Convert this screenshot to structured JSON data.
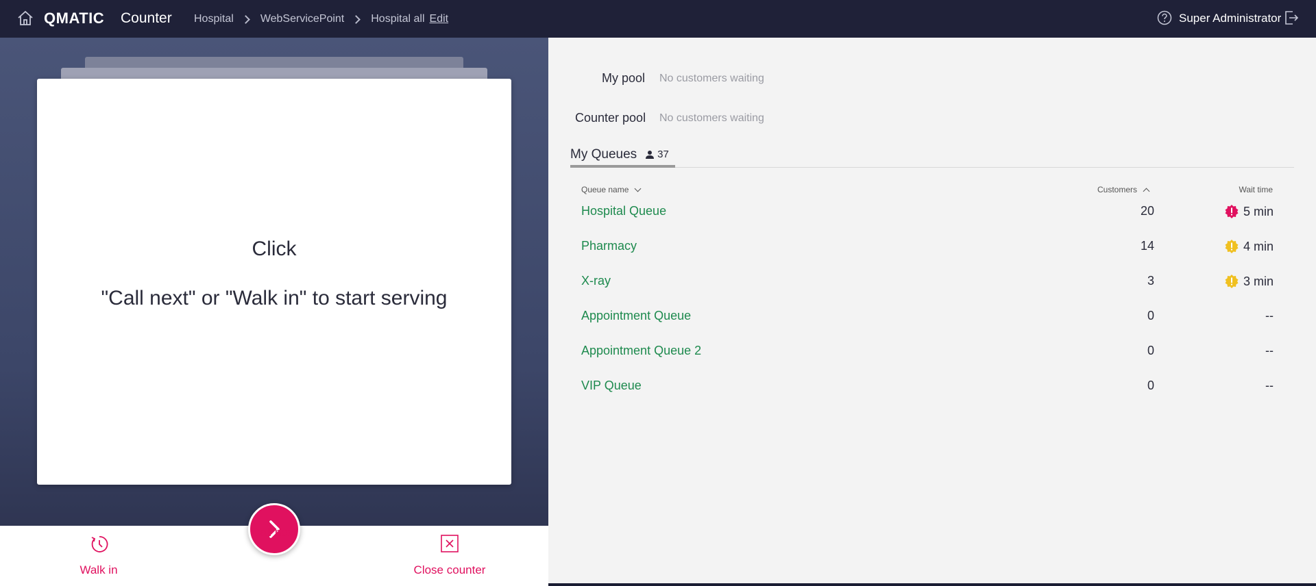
{
  "header": {
    "brand": "QMATIC",
    "app_title": "Counter",
    "breadcrumbs": [
      "Hospital",
      "WebServicePoint",
      "Hospital all"
    ],
    "edit_label": "Edit",
    "user_name": "Super Administrator"
  },
  "serving_card": {
    "title": "Click",
    "subtitle": "\"Call next\" or \"Walk in\" to start serving"
  },
  "actions": {
    "walk_in": "Walk in",
    "call_next": "Call next",
    "close_counter": "Close counter"
  },
  "pools": {
    "my_pool_label": "My pool",
    "my_pool_status": "No customers waiting",
    "counter_pool_label": "Counter pool",
    "counter_pool_status": "No customers waiting"
  },
  "queues": {
    "tab_label": "My Queues",
    "total_customers": "37",
    "columns": {
      "name": "Queue name",
      "customers": "Customers",
      "wait": "Wait time"
    },
    "rows": [
      {
        "name": "Hospital Queue",
        "customers": "20",
        "wait": "5 min",
        "level": "critical"
      },
      {
        "name": "Pharmacy",
        "customers": "14",
        "wait": "4 min",
        "level": "warning"
      },
      {
        "name": "X-ray",
        "customers": "3",
        "wait": "3 min",
        "level": "warning"
      },
      {
        "name": "Appointment Queue",
        "customers": "0",
        "wait": "--",
        "level": "none"
      },
      {
        "name": "Appointment Queue 2",
        "customers": "0",
        "wait": "--",
        "level": "none"
      },
      {
        "name": "VIP Queue",
        "customers": "0",
        "wait": "--",
        "level": "none"
      }
    ]
  },
  "colors": {
    "accent": "#e0115f",
    "queue_link": "#1e8a4e",
    "critical": "#e0115f",
    "warning": "#f0c020",
    "header_bg": "#1f2138"
  }
}
